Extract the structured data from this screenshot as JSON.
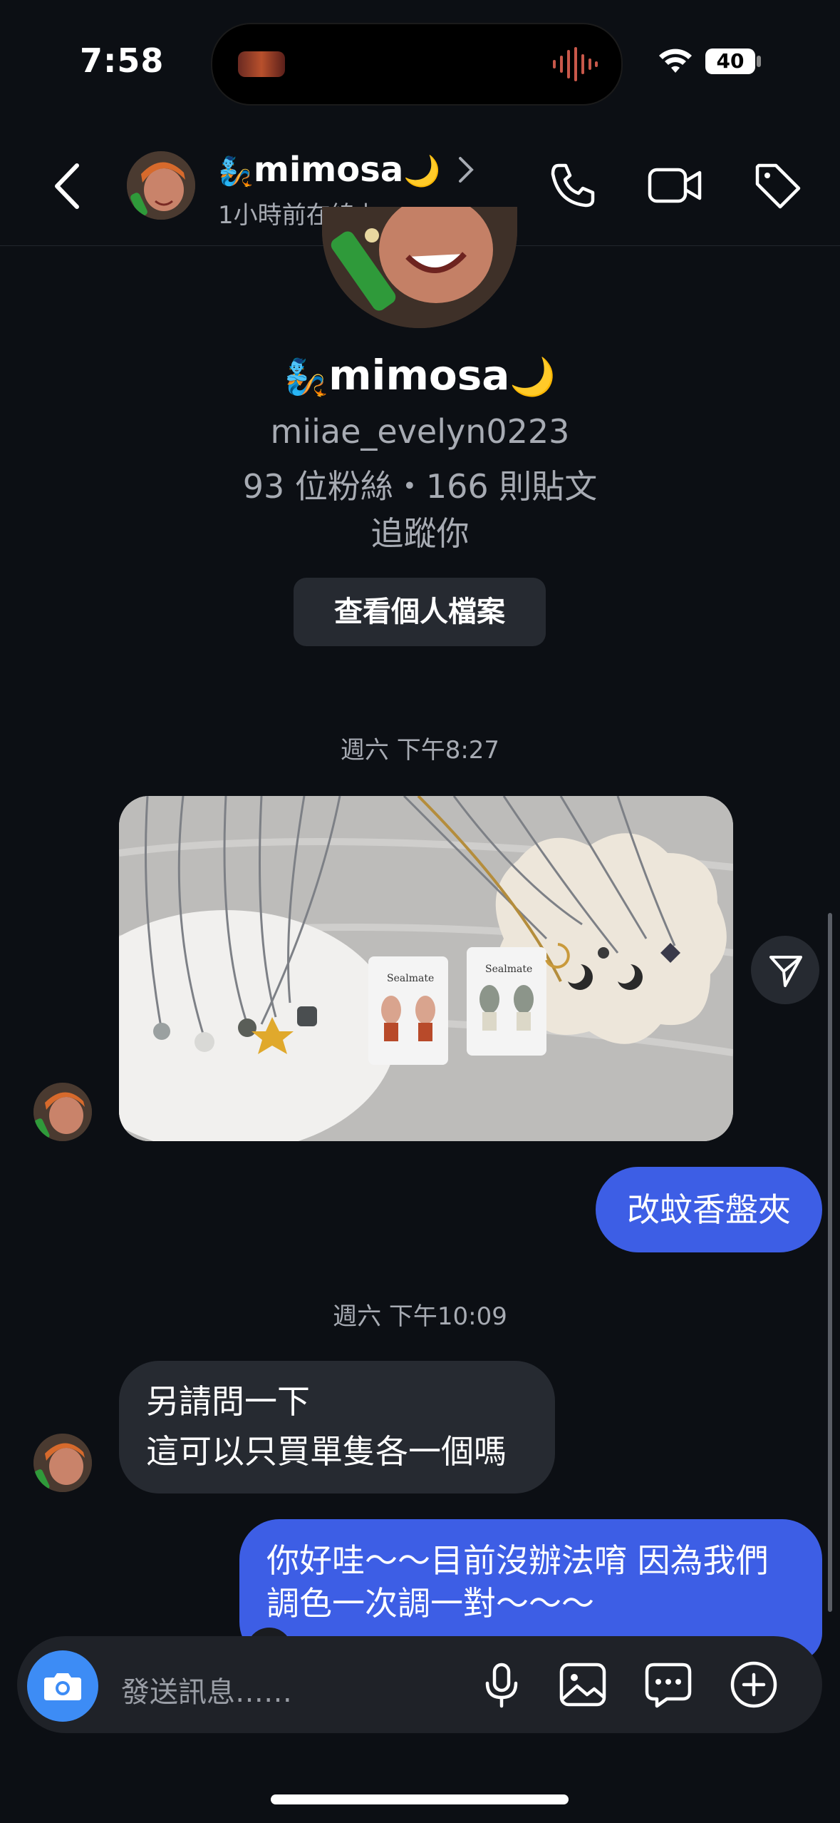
{
  "status_bar": {
    "time": "7:58",
    "battery": "40"
  },
  "header": {
    "name": "mimosa",
    "emoji_left": "🧞",
    "emoji_right": "🌙",
    "subtitle": "1小時前在線上"
  },
  "profile": {
    "name": "mimosa",
    "username": "miiae_evelyn0223",
    "stats": "93 位粉絲・166 則貼文",
    "follow_status": "追蹤你",
    "view_profile_label": "查看個人檔案"
  },
  "timestamps": {
    "first": "週六 下午8:27",
    "second": "週六 下午10:09"
  },
  "messages": {
    "outgoing_1": "改蚊香盤夾",
    "incoming_1": [
      "另請問一下",
      "這可以只買單隻各一個嗎"
    ],
    "outgoing_2": [
      "你好哇～～目前沒辦法唷 因為我們",
      "調色一次調一對～～～"
    ]
  },
  "photo": {
    "card_label_1": "Sealmate",
    "card_label_2": "Sealmate"
  },
  "composer": {
    "placeholder": "發送訊息……"
  },
  "colors": {
    "accent": "#3d5ee5",
    "background": "#0c0f14",
    "bubble_in": "#262a31",
    "camera": "#3d8cf5"
  }
}
